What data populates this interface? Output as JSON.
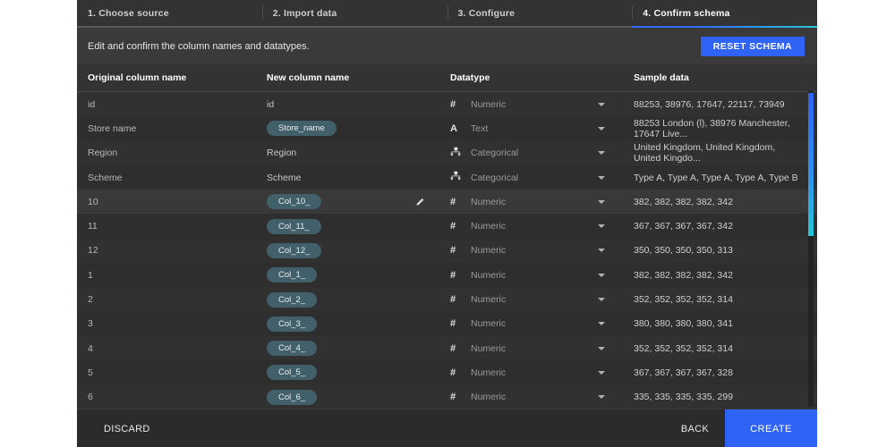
{
  "stepper": {
    "steps": [
      {
        "label": "1. Choose source",
        "active": false
      },
      {
        "label": "2. Import data",
        "active": false
      },
      {
        "label": "3. Configure",
        "active": false
      },
      {
        "label": "4. Confirm schema",
        "active": true
      }
    ]
  },
  "subheader": {
    "description": "Edit and confirm the column names and datatypes.",
    "reset_label": "RESET SCHEMA"
  },
  "table": {
    "headers": [
      "Original column name",
      "New column name",
      "Datatype",
      "Sample data"
    ],
    "rows": [
      {
        "original": "id",
        "new": "id",
        "chip": false,
        "edit": false,
        "datatype": "Numeric",
        "icon": "#",
        "sample": "88253, 38976, 17647, 22117, 73949"
      },
      {
        "original": "Store name",
        "new": "Store_name",
        "chip": true,
        "edit": false,
        "datatype": "Text",
        "icon": "A",
        "sample": "88253 London (l), 38976 Manchester, 17647 Live..."
      },
      {
        "original": "Region",
        "new": "Region",
        "chip": false,
        "edit": false,
        "datatype": "Categorical",
        "icon": "tree",
        "sample": "United Kingdom, United Kingdom, United Kingdo..."
      },
      {
        "original": "Scheme",
        "new": "Scheme",
        "chip": false,
        "edit": false,
        "datatype": "Categorical",
        "icon": "tree",
        "sample": "Type A, Type A, Type A, Type A, Type B"
      },
      {
        "original": "10",
        "new": "Col_10_",
        "chip": true,
        "edit": true,
        "datatype": "Numeric",
        "icon": "#",
        "sample": "382, 382, 382, 382, 342"
      },
      {
        "original": "11",
        "new": "Col_11_",
        "chip": true,
        "edit": false,
        "datatype": "Numeric",
        "icon": "#",
        "sample": "367, 367, 367, 367, 342"
      },
      {
        "original": "12",
        "new": "Col_12_",
        "chip": true,
        "edit": false,
        "datatype": "Numeric",
        "icon": "#",
        "sample": "350, 350, 350, 350, 313"
      },
      {
        "original": "1",
        "new": "Col_1_",
        "chip": true,
        "edit": false,
        "datatype": "Numeric",
        "icon": "#",
        "sample": "382, 382, 382, 382, 342"
      },
      {
        "original": "2",
        "new": "Col_2_",
        "chip": true,
        "edit": false,
        "datatype": "Numeric",
        "icon": "#",
        "sample": "352, 352, 352, 352, 314"
      },
      {
        "original": "3",
        "new": "Col_3_",
        "chip": true,
        "edit": false,
        "datatype": "Numeric",
        "icon": "#",
        "sample": "380, 380, 380, 380, 341"
      },
      {
        "original": "4",
        "new": "Col_4_",
        "chip": true,
        "edit": false,
        "datatype": "Numeric",
        "icon": "#",
        "sample": "352, 352, 352, 352, 314"
      },
      {
        "original": "5",
        "new": "Col_5_",
        "chip": true,
        "edit": false,
        "datatype": "Numeric",
        "icon": "#",
        "sample": "367, 367, 367, 367, 328"
      },
      {
        "original": "6",
        "new": "Col_6_",
        "chip": true,
        "edit": false,
        "datatype": "Numeric",
        "icon": "#",
        "sample": "335, 335, 335, 335, 299"
      }
    ]
  },
  "footer": {
    "discard_label": "DISCARD",
    "back_label": "BACK",
    "create_label": "CREATE"
  },
  "colors": {
    "accent_blue": "#2f63f5",
    "accent_cyan": "#22c7d6",
    "chip_bg": "#42606a",
    "panel_bg": "#2b2b2b"
  }
}
